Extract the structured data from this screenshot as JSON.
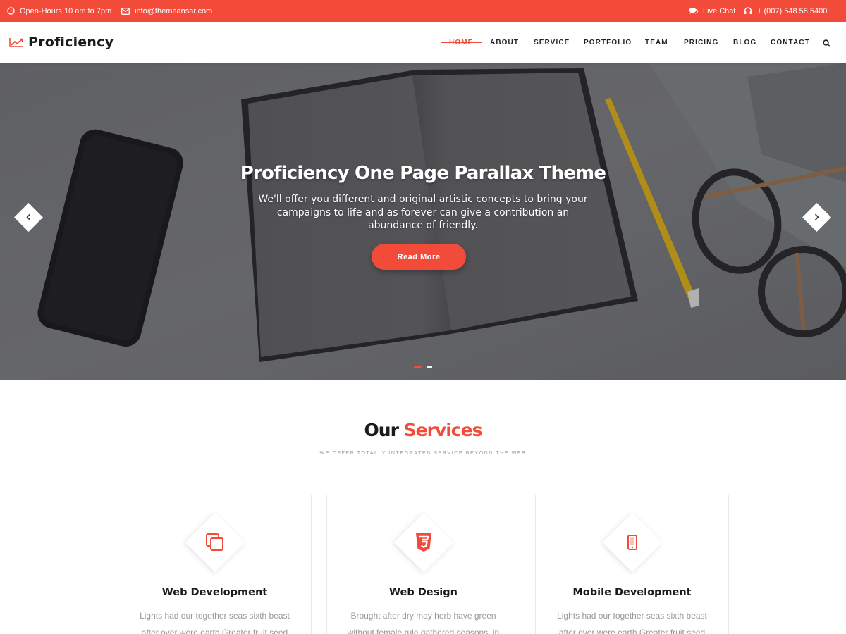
{
  "topbar": {
    "hours": "Open-Hours:10 am to 7pm",
    "email": "info@themeansar.com",
    "chat": "Live Chat",
    "phone": "+ (007) 548 58 5400"
  },
  "brand": {
    "name": "Proficiency"
  },
  "nav": {
    "items": [
      {
        "label": "HOME"
      },
      {
        "label": "ABOUT"
      },
      {
        "label": "SERVICE"
      },
      {
        "label": "PORTFOLIO"
      },
      {
        "label": "TEAM"
      },
      {
        "label": "PRICING"
      },
      {
        "label": "BLOG"
      },
      {
        "label": "CONTACT"
      }
    ],
    "active_index": 0
  },
  "hero": {
    "title": "Proficiency One Page Parallax Theme",
    "subtitle": "We'll offer you different and original artistic concepts to bring your campaigns to life and as forever can give a contribution an abundance of friendly.",
    "button": "Read More",
    "slide_count": 2,
    "active_slide": 1
  },
  "services": {
    "title_dark": "Our",
    "title_accent": "Services",
    "subtitle": "WE OFFER TOTALLY INTEGRATED SERVICE BEYOND THE WEB",
    "cards": [
      {
        "icon": "copy-icon",
        "title": "Web Development",
        "text": "Lights had our together seas sixth beast after over were earth Greater fruit seed"
      },
      {
        "icon": "css3-icon",
        "title": "Web Design",
        "text": "Brought after dry may herb have green without female rule gathered seasons, in"
      },
      {
        "icon": "mobile-icon",
        "title": "Mobile Development",
        "text": "Lights had our together seas sixth beast after over were earth Greater fruit seed"
      }
    ]
  },
  "colors": {
    "accent": "#f34b3a",
    "text_dark": "#1b1b1b",
    "muted": "#999999"
  }
}
